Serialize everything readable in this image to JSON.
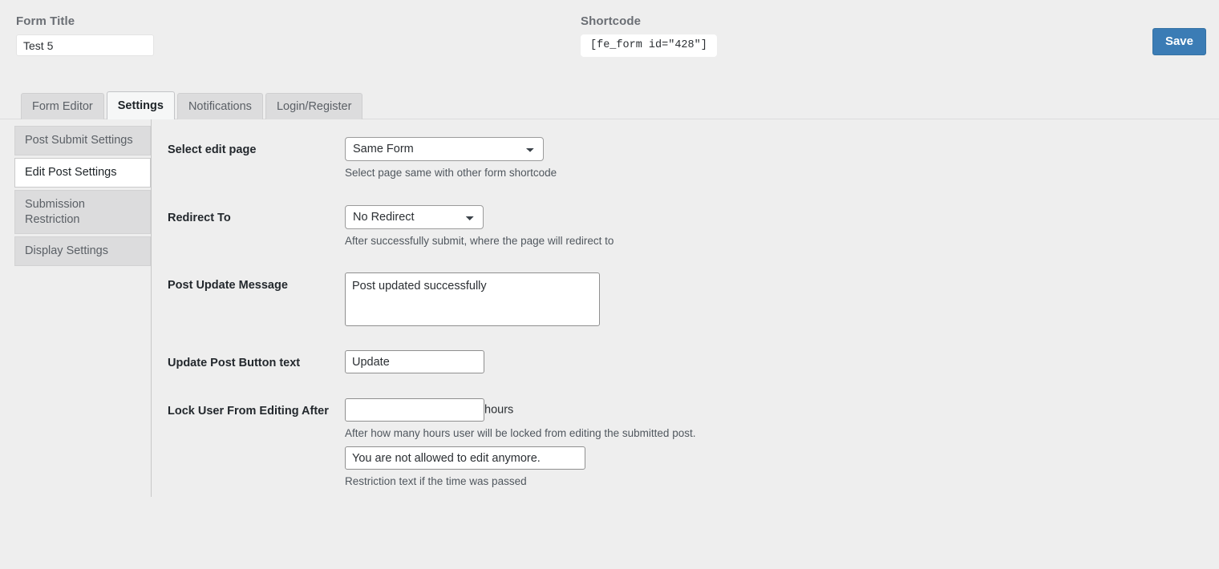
{
  "header": {
    "form_title_label": "Form Title",
    "form_title_value": "Test 5",
    "shortcode_label": "Shortcode",
    "shortcode_value": "[fe_form id=\"428\"]",
    "save_label": "Save"
  },
  "tabs": [
    {
      "label": "Form Editor",
      "active": false
    },
    {
      "label": "Settings",
      "active": true
    },
    {
      "label": "Notifications",
      "active": false
    },
    {
      "label": "Login/Register",
      "active": false
    }
  ],
  "sidebar": {
    "items": [
      {
        "label": "Post Submit Settings",
        "active": false
      },
      {
        "label": "Edit Post Settings",
        "active": true
      },
      {
        "label": "Submission Restriction",
        "active": false
      },
      {
        "label": "Display Settings",
        "active": false
      }
    ]
  },
  "fields": {
    "select_edit_page": {
      "label": "Select edit page",
      "value": "Same Form",
      "options": [
        "Same Form"
      ],
      "help": "Select page same with other form shortcode"
    },
    "redirect_to": {
      "label": "Redirect To",
      "value": "No Redirect",
      "options": [
        "No Redirect"
      ],
      "help": "After successfully submit, where the page will redirect to"
    },
    "post_update_message": {
      "label": "Post Update Message",
      "value": "Post updated successfully"
    },
    "update_post_button_text": {
      "label": "Update Post Button text",
      "value": "Update"
    },
    "lock_user": {
      "label": "Lock User From Editing After",
      "value": "",
      "unit": "hours",
      "help": "After how many hours user will be locked from editing the submitted post.",
      "restriction_value": "You are not allowed to edit anymore.",
      "restriction_help": "Restriction text if the time was passed"
    }
  },
  "colors": {
    "accent": "#3b7cb5",
    "page_bg": "#eeeeee",
    "tab_inactive_bg": "#dcdcdd"
  }
}
